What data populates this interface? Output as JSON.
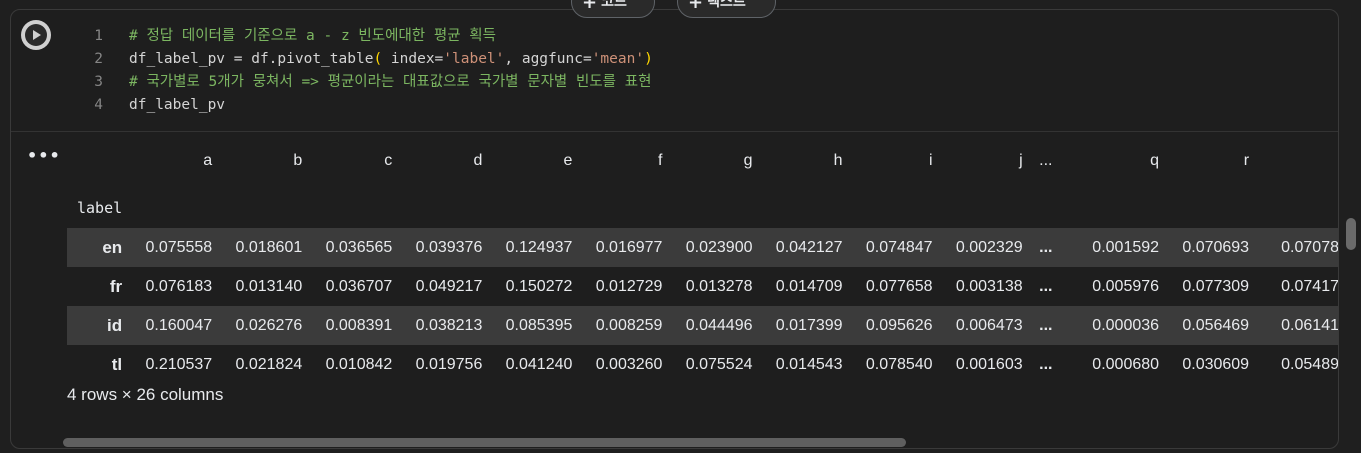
{
  "toolbar": {
    "add_code": "코드",
    "add_text": "텍스트",
    "plus": "+"
  },
  "code": {
    "lines": [
      {
        "num": "1",
        "parts": [
          {
            "t": "# 정답 데이터를 기준으로 a - z 빈도에대한 평균 획득",
            "c": "comment"
          }
        ]
      },
      {
        "num": "2",
        "parts": [
          {
            "t": "df_label_pv = df.pivot_table",
            "c": "plain"
          },
          {
            "t": "(",
            "c": "paren"
          },
          {
            "t": " index=",
            "c": "plain"
          },
          {
            "t": "'label'",
            "c": "str"
          },
          {
            "t": ", aggfunc=",
            "c": "plain"
          },
          {
            "t": "'mean'",
            "c": "str"
          },
          {
            "t": ")",
            "c": "paren"
          }
        ]
      },
      {
        "num": "3",
        "parts": [
          {
            "t": "# 국가별로 5개가 뭉쳐서 => 평균이라는 대표값으로 국가별 문자별 빈도를 표현",
            "c": "comment"
          }
        ]
      },
      {
        "num": "4",
        "parts": [
          {
            "t": "df_label_pv",
            "c": "plain"
          }
        ]
      }
    ]
  },
  "output": {
    "menu_icon": "•••",
    "index_name": "label",
    "columns": [
      "a",
      "b",
      "c",
      "d",
      "e",
      "f",
      "g",
      "h",
      "i",
      "j",
      "...",
      "q",
      "r"
    ],
    "rows": [
      {
        "label": "en",
        "values": [
          "0.075558",
          "0.018601",
          "0.036565",
          "0.039376",
          "0.124937",
          "0.016977",
          "0.023900",
          "0.042127",
          "0.074847",
          "0.002329",
          "...",
          "0.001592",
          "0.070693",
          "0.07078"
        ]
      },
      {
        "label": "fr",
        "values": [
          "0.076183",
          "0.013140",
          "0.036707",
          "0.049217",
          "0.150272",
          "0.012729",
          "0.013278",
          "0.014709",
          "0.077658",
          "0.003138",
          "...",
          "0.005976",
          "0.077309",
          "0.07417"
        ]
      },
      {
        "label": "id",
        "values": [
          "0.160047",
          "0.026276",
          "0.008391",
          "0.038213",
          "0.085395",
          "0.008259",
          "0.044496",
          "0.017399",
          "0.095626",
          "0.006473",
          "...",
          "0.000036",
          "0.056469",
          "0.06141"
        ]
      },
      {
        "label": "tl",
        "values": [
          "0.210537",
          "0.021824",
          "0.010842",
          "0.019756",
          "0.041240",
          "0.003260",
          "0.075524",
          "0.014543",
          "0.078540",
          "0.001603",
          "...",
          "0.000680",
          "0.030609",
          "0.05489"
        ]
      }
    ],
    "shape_text": "4 rows × 26 columns"
  },
  "colors": {
    "background": "#1e1e1e",
    "comment": "#7cb661",
    "string": "#ce9178",
    "paren": "#ffd700",
    "row_stripe": "#3b3b3b"
  }
}
